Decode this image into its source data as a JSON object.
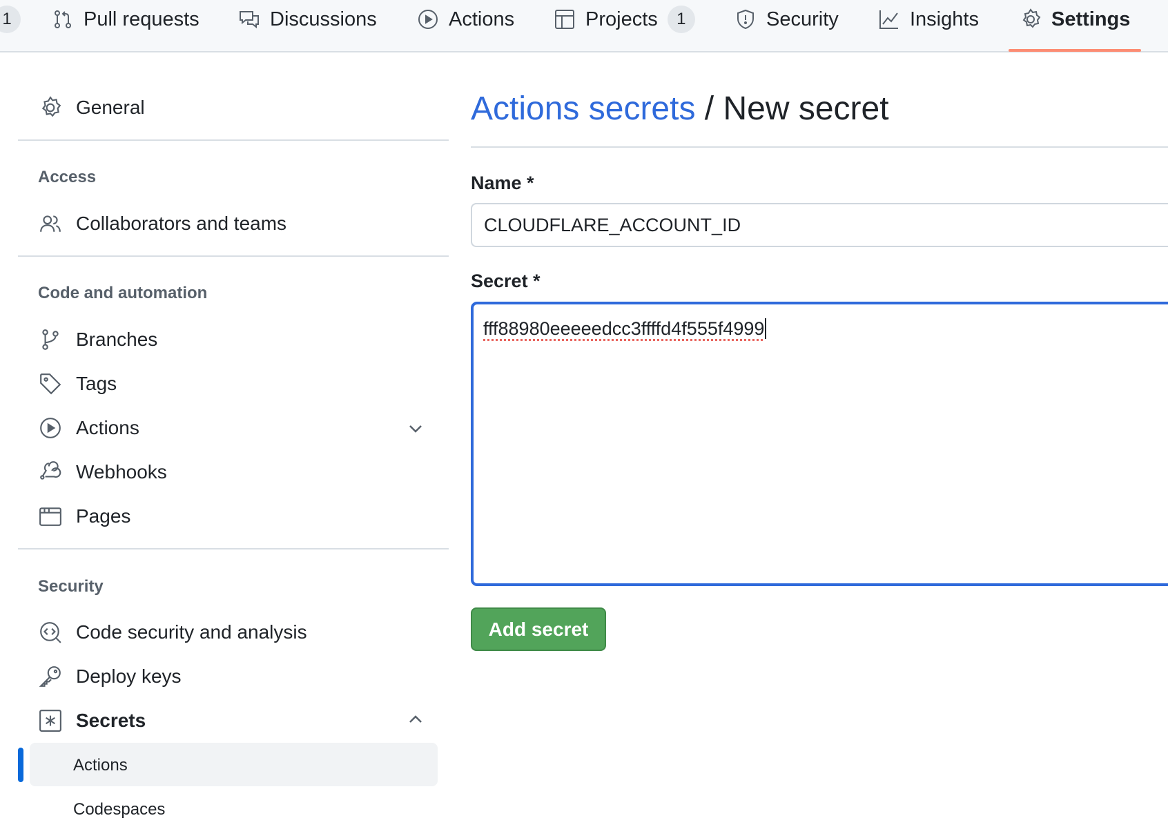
{
  "nav": {
    "leading_counter": "1",
    "tabs": [
      {
        "label": "Pull requests",
        "icon": "git-pull-request-icon"
      },
      {
        "label": "Discussions",
        "icon": "comment-discussion-icon"
      },
      {
        "label": "Actions",
        "icon": "play-icon"
      },
      {
        "label": "Projects",
        "icon": "table-icon",
        "counter": "1"
      },
      {
        "label": "Security",
        "icon": "shield-icon"
      },
      {
        "label": "Insights",
        "icon": "graph-icon"
      },
      {
        "label": "Settings",
        "icon": "gear-icon",
        "selected": true
      }
    ],
    "accent": "#fd8c73"
  },
  "sidebar": {
    "general": "General",
    "access_heading": "Access",
    "collaborators": "Collaborators and teams",
    "code_heading": "Code and automation",
    "branches": "Branches",
    "tags": "Tags",
    "actions": "Actions",
    "webhooks": "Webhooks",
    "pages": "Pages",
    "security_heading": "Security",
    "code_security": "Code security and analysis",
    "deploy_keys": "Deploy keys",
    "secrets": "Secrets",
    "secrets_sub": [
      "Actions",
      "Codespaces"
    ]
  },
  "main": {
    "breadcrumb_link": "Actions secrets",
    "separator": " / ",
    "title": "New secret",
    "name_label": "Name *",
    "name_value": "CLOUDFLARE_ACCOUNT_ID",
    "secret_label": "Secret *",
    "secret_value": "fff88980eeeeedcc3ffffd4f555f4999",
    "submit": "Add secret",
    "submit_color": "#52a45a",
    "link_color": "#2f6adb"
  }
}
